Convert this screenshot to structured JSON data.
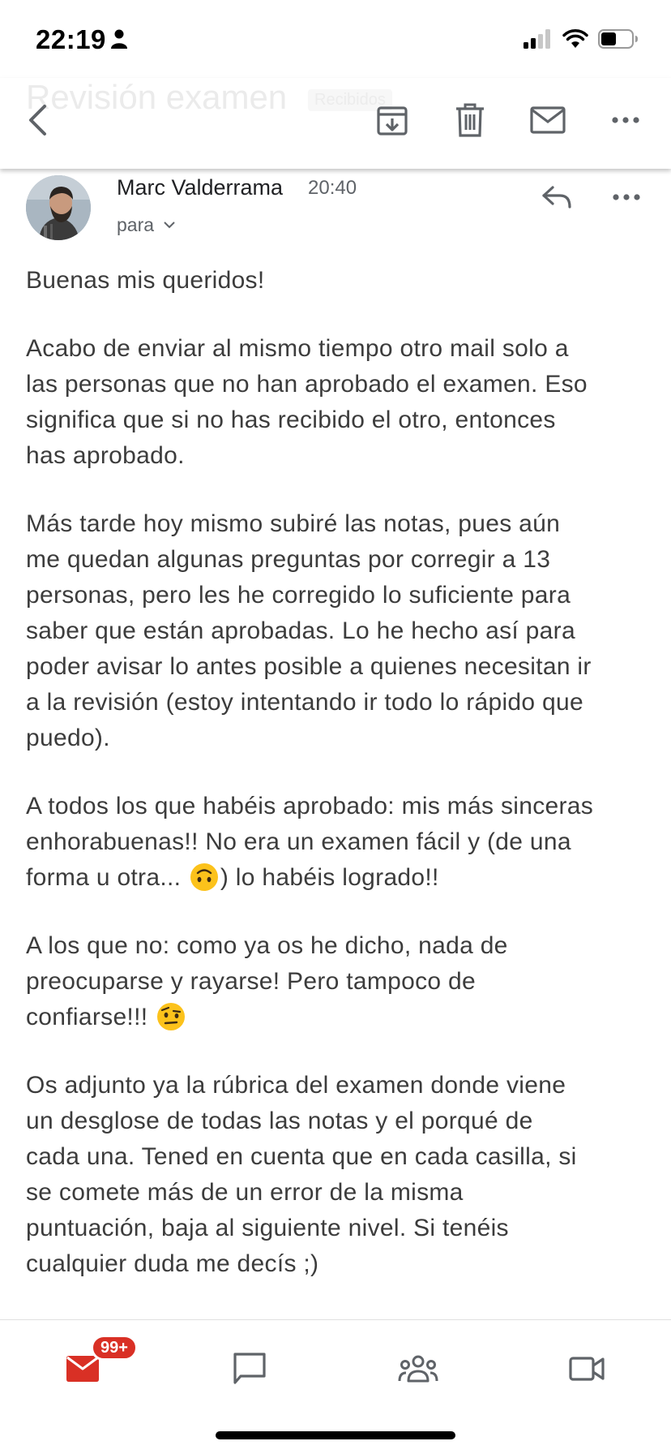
{
  "status_bar": {
    "time": "22:19",
    "icons": [
      "person-icon",
      "signal-icon",
      "wifi-icon",
      "battery-icon"
    ]
  },
  "toolbar": {
    "ghost_subject": "Revisión examen",
    "ghost_label": "Recibidos",
    "icons": [
      "back-arrow-icon",
      "archive-icon",
      "delete-icon",
      "mark-unread-icon",
      "more-vert-icon"
    ]
  },
  "email": {
    "sender": "Marc Valderrama",
    "time": "20:40",
    "recipient_label": "para",
    "paragraphs": [
      {
        "lines": [
          "Buenas mis queridos!"
        ]
      },
      {
        "lines": [
          "Acabo de enviar al mismo tiempo otro mail solo a",
          "las personas que no han aprobado el examen. Eso",
          "significa que si no has recibido el otro, entonces",
          "has aprobado."
        ]
      },
      {
        "lines": [
          "Más tarde hoy mismo subiré las notas, pues aún",
          "me quedan algunas preguntas por corregir a 13",
          "personas, pero les he corregido lo suficiente para",
          "saber que están aprobadas. Lo he hecho así para",
          "poder avisar lo antes posible a quienes necesitan ir",
          "a la revisión (estoy intentando ir todo lo rápido que",
          "puedo)."
        ]
      },
      {
        "lines": [
          "A todos los que habéis aprobado: mis más sinceras",
          "enhorabuenas!! No era un examen fácil y (de una"
        ],
        "line_with_emoji": {
          "before": "forma u otra... ",
          "emoji": "upside-down-face-emoji",
          "after": ") lo habéis logrado!!"
        }
      },
      {
        "lines": [
          "A los que no: como ya os he dicho, nada de",
          "preocuparse y rayarse! Pero tampoco de"
        ],
        "line_with_emoji": {
          "before": "confiarse!!! ",
          "emoji": "raised-eyebrow-emoji",
          "after": ""
        }
      },
      {
        "lines": [
          "Os adjunto ya la rúbrica del examen donde viene",
          "un desglose de todas las notas y el porqué de",
          "cada una. Tened en cuenta que en cada casilla, si",
          "se comete más de un error de la misma",
          "puntuación, baja al siguiente nivel. Si tenéis",
          "cualquier duda me decís ;)"
        ]
      }
    ]
  },
  "bottom_nav": {
    "mail_badge": "99+",
    "items": [
      "mail-icon",
      "chat-icon",
      "spaces-icon",
      "meet-icon"
    ],
    "accent": "#d93025"
  }
}
